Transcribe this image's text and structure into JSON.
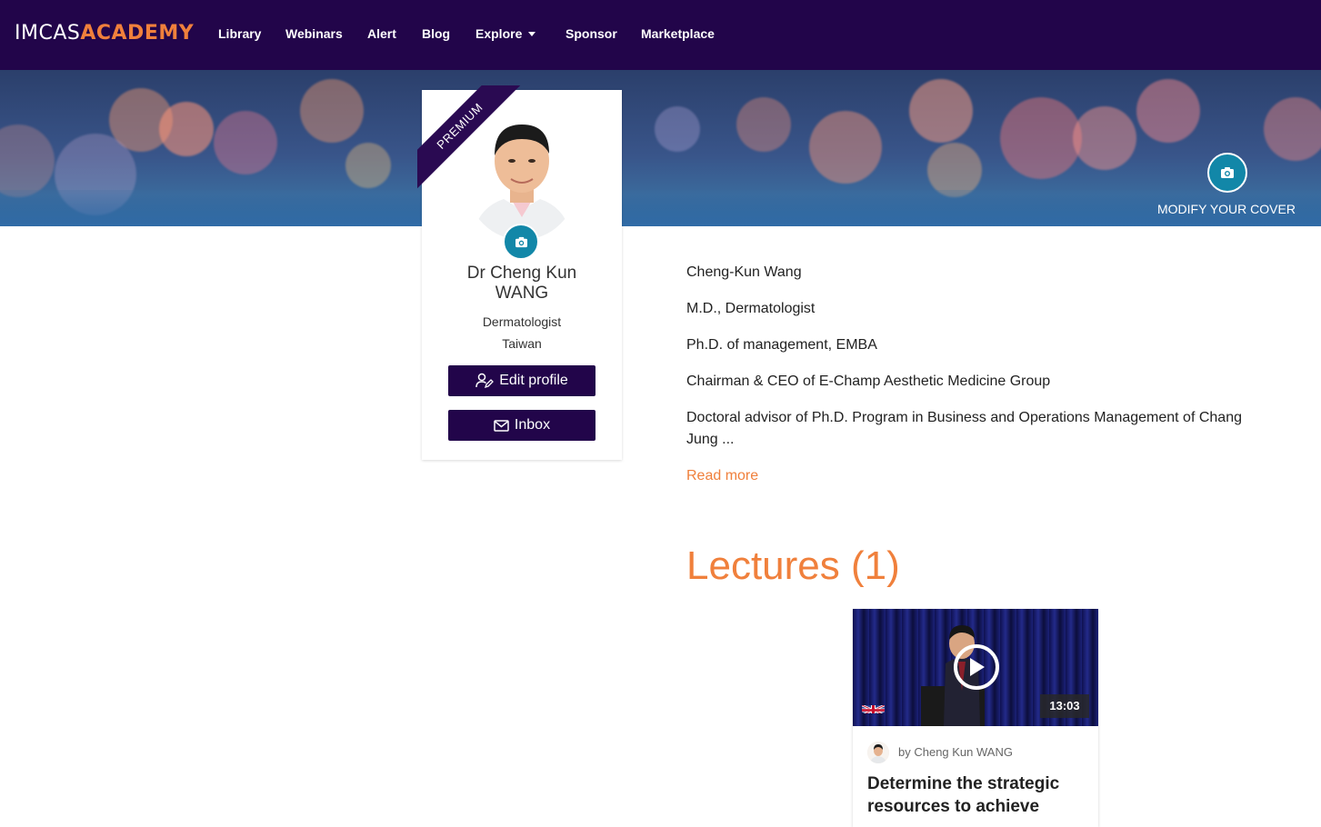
{
  "nav": {
    "logo_part1": "IMCAS",
    "logo_part2": "ACADEMY",
    "items": [
      "Library",
      "Webinars",
      "Alert",
      "Blog",
      "Explore",
      "Sponsor",
      "Marketplace"
    ]
  },
  "cover": {
    "modify_label": "MODIFY YOUR COVER",
    "camera_icon": "camera-icon"
  },
  "profile": {
    "badge": "PREMIUM",
    "name_line1": "Dr Cheng Kun",
    "name_line2": "WANG",
    "specialty": "Dermatologist",
    "country": "Taiwan",
    "edit_label": "Edit profile",
    "inbox_label": "Inbox"
  },
  "bio": {
    "lines": [
      "Cheng-Kun Wang",
      "M.D., Dermatologist",
      "Ph.D. of management, EMBA",
      "Chairman & CEO of E-Champ Aesthetic Medicine Group",
      "Doctoral advisor of Ph.D. Program in Business and Operations Management of Chang",
      "Jung ..."
    ],
    "read_more": "Read more"
  },
  "lectures": {
    "heading": "Lectures (1)",
    "items": [
      {
        "duration": "13:03",
        "author": "by Cheng Kun WANG",
        "title_line1": "Determine the strategic",
        "title_line2": "resources to achieve"
      }
    ]
  },
  "colors": {
    "nav_bg": "#22054a",
    "accent": "#f0803c",
    "camera_teal": "#1287a8",
    "button_bg": "#22054a"
  }
}
